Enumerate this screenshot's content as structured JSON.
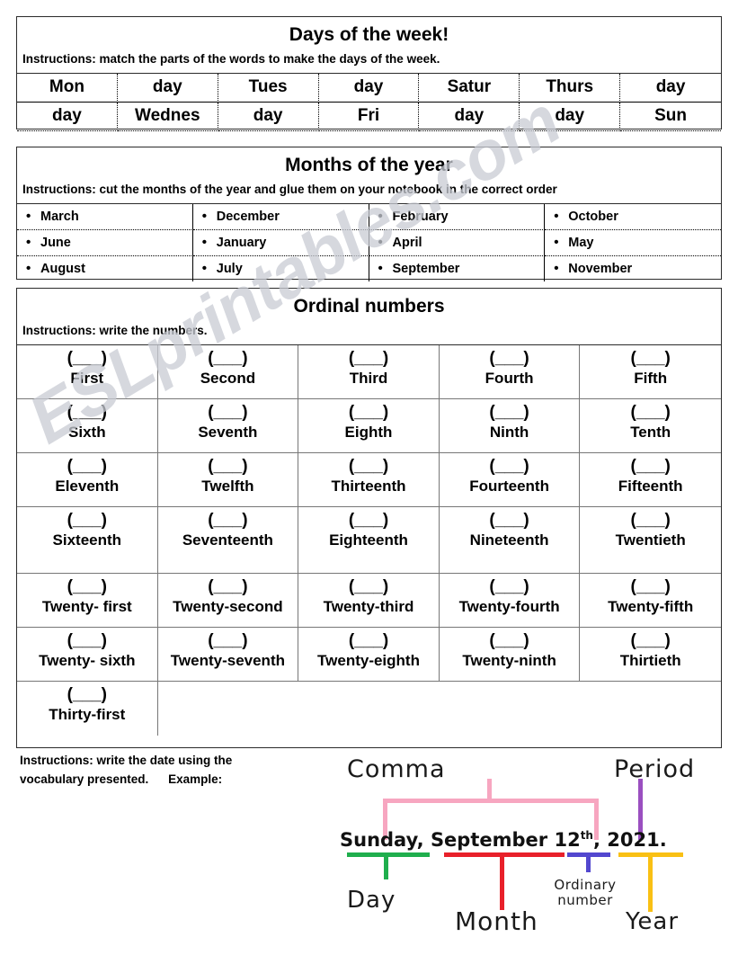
{
  "worksheet": {
    "watermark": "ESLprintables.com"
  },
  "days_section": {
    "title": "Days of the week!",
    "instructions": "Instructions: match the parts of the words to make the days of the week.",
    "row1": [
      "Mon",
      "day",
      "Tues",
      "day",
      "Satur",
      "Thurs",
      "day"
    ],
    "row2": [
      "day",
      "Wednes",
      "day",
      "Fri",
      "day",
      "day",
      "Sun"
    ]
  },
  "months_section": {
    "title": "Months of the year",
    "instructions": "Instructions: cut the months of the year and glue them on your notebook in the correct order",
    "bullet": "•",
    "rows": [
      [
        "March",
        "December",
        "February",
        "October"
      ],
      [
        "June",
        "January",
        "April",
        "May"
      ],
      [
        "August",
        "July",
        "September",
        "November"
      ]
    ]
  },
  "ordinals_section": {
    "title": "Ordinal numbers",
    "instructions": "Instructions: write the numbers.",
    "blank": "(___)",
    "rows": [
      [
        "First",
        "Second",
        "Third",
        "Fourth",
        "Fifth"
      ],
      [
        "Sixth",
        "Seventh",
        "Eighth",
        "Ninth",
        "Tenth"
      ],
      [
        "Eleventh",
        "Twelfth",
        "Thirteenth",
        "Fourteenth",
        "Fifteenth"
      ],
      [
        "Sixteenth",
        "Seventeenth",
        "Eighteenth",
        "Nineteenth",
        "Twentieth"
      ],
      [
        "Twenty- first",
        "Twenty-second",
        "Twenty-third",
        "Twenty-fourth",
        "Twenty-fifth"
      ],
      [
        "Twenty- sixth",
        "Twenty-seventh",
        "Twenty-eighth",
        "Twenty-ninth",
        "Thirtieth"
      ],
      [
        "Thirty-first",
        "",
        "",
        "",
        ""
      ]
    ]
  },
  "date_section": {
    "instructions_line1": "Instructions: write the date using the",
    "instructions_line2": "vocabulary presented.",
    "example_label": "Example:",
    "date_example": {
      "day": "Sunday",
      "comma1": ",",
      "month": "September",
      "number": "12",
      "suffix": "th",
      "comma2": ",",
      "year": "2021",
      "period": "."
    },
    "labels": {
      "comma": "Comma",
      "period": "Period",
      "day": "Day",
      "month": "Month",
      "ordinary_number": "Ordinary number",
      "year": "Year"
    },
    "colors": {
      "day": "#1fae4d",
      "month": "#e8202a",
      "ordinary_number": "#5247cf",
      "year": "#f9c014",
      "comma": "#f7a6c0",
      "period": "#9a4fc0"
    }
  }
}
